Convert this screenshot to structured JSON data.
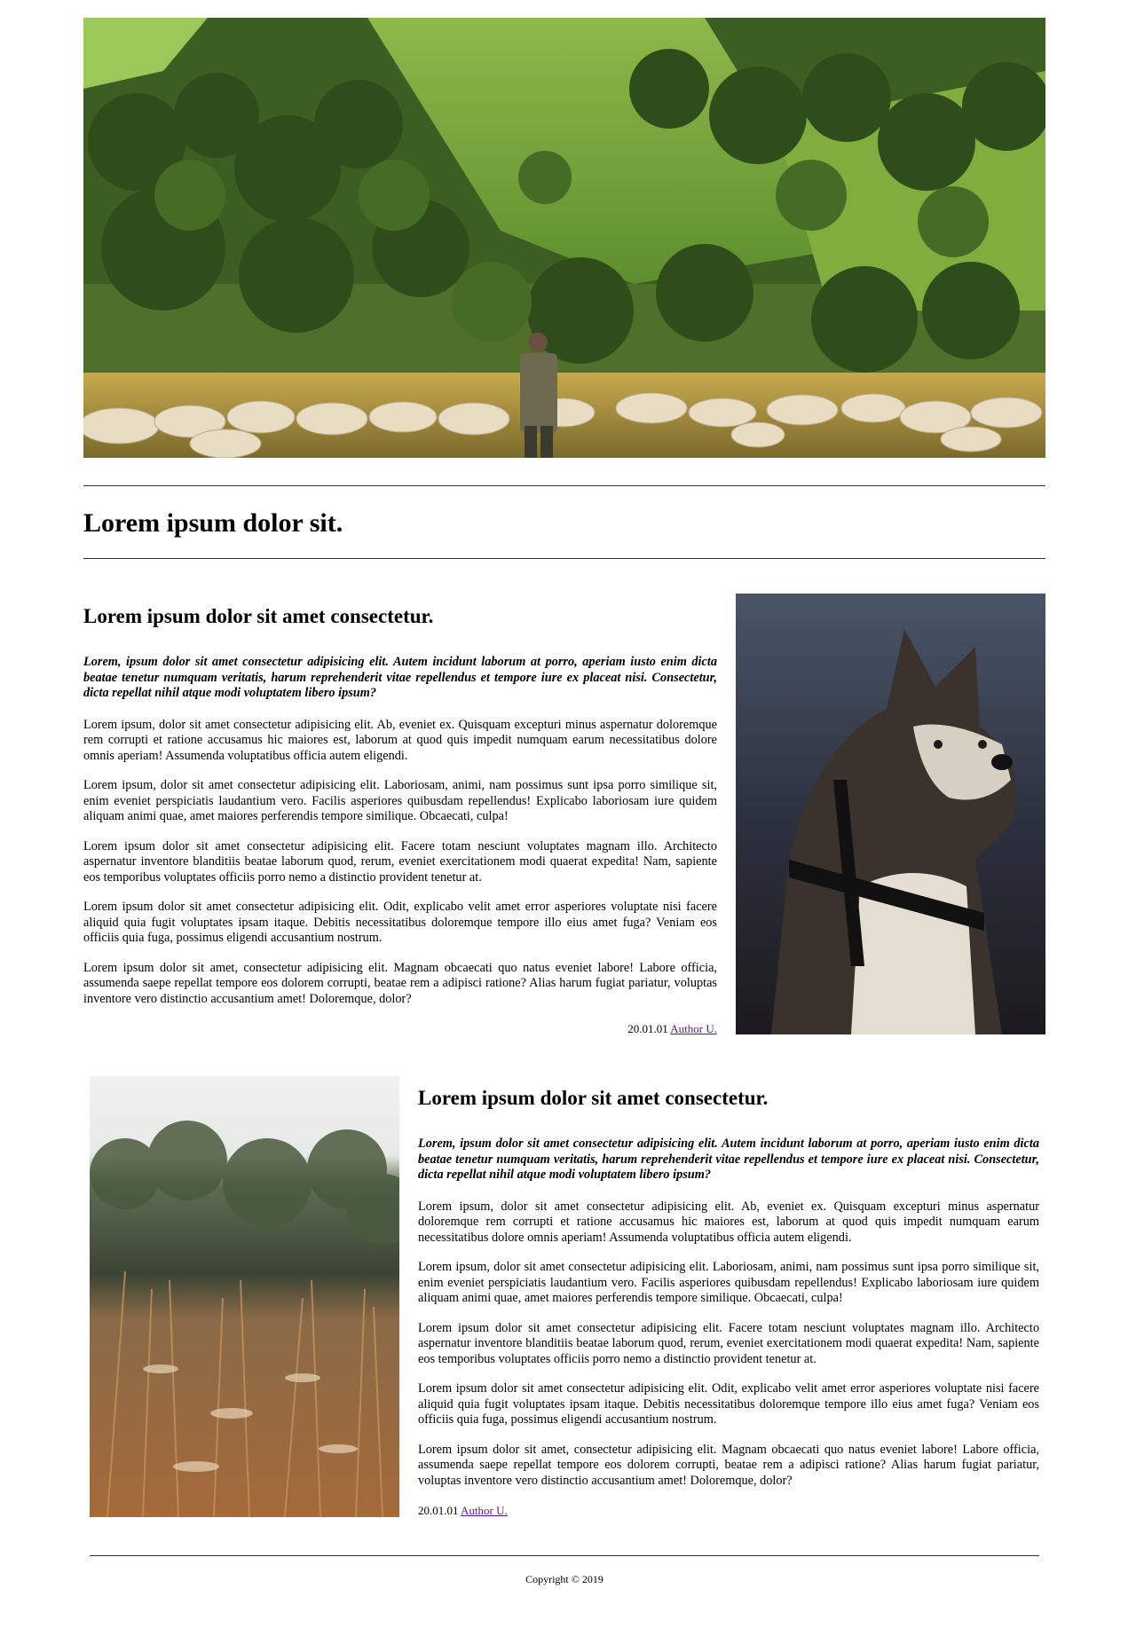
{
  "page": {
    "title": "Lorem ipsum dolor sit."
  },
  "articles": [
    {
      "heading": "Lorem ipsum dolor sit amet consectetur.",
      "lead": "Lorem, ipsum dolor sit amet consectetur adipisicing elit. Autem incidunt laborum at porro, aperiam iusto enim dicta beatae tenetur numquam veritatis, harum reprehenderit vitae repellendus et tempore iure ex placeat nisi. Consectetur, dicta repellat nihil atque modi voluptatem libero ipsum?",
      "paragraphs": [
        "Lorem ipsum, dolor sit amet consectetur adipisicing elit. Ab, eveniet ex. Quisquam excepturi minus aspernatur doloremque rem corrupti et ratione accusamus hic maiores est, laborum at quod quis impedit numquam earum necessitatibus dolore omnis aperiam! Assumenda voluptatibus officia autem eligendi.",
        "Lorem ipsum, dolor sit amet consectetur adipisicing elit. Laboriosam, animi, nam possimus sunt ipsa porro similique sit, enim eveniet perspiciatis laudantium vero. Facilis asperiores quibusdam repellendus! Explicabo laboriosam iure quidem aliquam animi quae, amet maiores perferendis tempore similique. Obcaecati, culpa!",
        "Lorem ipsum dolor sit amet consectetur adipisicing elit. Facere totam nesciunt voluptates magnam illo. Architecto aspernatur inventore blanditiis beatae laborum quod, rerum, eveniet exercitationem modi quaerat expedita! Nam, sapiente eos temporibus voluptates officiis porro nemo a distinctio provident tenetur at.",
        "Lorem ipsum dolor sit amet consectetur adipisicing elit. Odit, explicabo velit amet error asperiores voluptate nisi facere aliquid quia fugit voluptates ipsam itaque. Debitis necessitatibus doloremque tempore illo eius amet fuga? Veniam eos officiis quia fuga, possimus eligendi accusantium nostrum.",
        "Lorem ipsum dolor sit amet, consectetur adipisicing elit. Magnam obcaecati quo natus eveniet labore! Labore officia, assumenda saepe repellat tempore eos dolorem corrupti, beatae rem a adipisci ratione? Alias harum fugiat pariatur, voluptas inventore vero distinctio accusantium amet! Doloremque, dolor?"
      ],
      "date": "20.01.01",
      "author": "Author U."
    },
    {
      "heading": "Lorem ipsum dolor sit amet consectetur.",
      "lead": "Lorem, ipsum dolor sit amet consectetur adipisicing elit. Autem incidunt laborum at porro, aperiam iusto enim dicta beatae tenetur numquam veritatis, harum reprehenderit vitae repellendus et tempore iure ex placeat nisi. Consectetur, dicta repellat nihil atque modi voluptatem libero ipsum?",
      "paragraphs": [
        "Lorem ipsum, dolor sit amet consectetur adipisicing elit. Ab, eveniet ex. Quisquam excepturi minus aspernatur doloremque rem corrupti et ratione accusamus hic maiores est, laborum at quod quis impedit numquam earum necessitatibus dolore omnis aperiam! Assumenda voluptatibus officia autem eligendi.",
        "Lorem ipsum, dolor sit amet consectetur adipisicing elit. Laboriosam, animi, nam possimus sunt ipsa porro similique sit, enim eveniet perspiciatis laudantium vero. Facilis asperiores quibusdam repellendus! Explicabo laboriosam iure quidem aliquam animi quae, amet maiores perferendis tempore similique. Obcaecati, culpa!",
        "Lorem ipsum dolor sit amet consectetur adipisicing elit. Facere totam nesciunt voluptates magnam illo. Architecto aspernatur inventore blanditiis beatae laborum quod, rerum, eveniet exercitationem modi quaerat expedita! Nam, sapiente eos temporibus voluptates officiis porro nemo a distinctio provident tenetur at.",
        "Lorem ipsum dolor sit amet consectetur adipisicing elit. Odit, explicabo velit amet error asperiores voluptate nisi facere aliquid quia fugit voluptates ipsam itaque. Debitis necessitatibus doloremque tempore illo eius amet fuga? Veniam eos officiis quia fuga, possimus eligendi accusantium nostrum.",
        "Lorem ipsum dolor sit amet, consectetur adipisicing elit. Magnam obcaecati quo natus eveniet labore! Labore officia, assumenda saepe repellat tempore eos dolorem corrupti, beatae rem a adipisci ratione? Alias harum fugiat pariatur, voluptas inventore vero distinctio accusantium amet! Doloremque, dolor?"
      ],
      "date": "20.01.01",
      "author": "Author U."
    }
  ],
  "footer": {
    "copyright": "Copyright © 2019"
  }
}
